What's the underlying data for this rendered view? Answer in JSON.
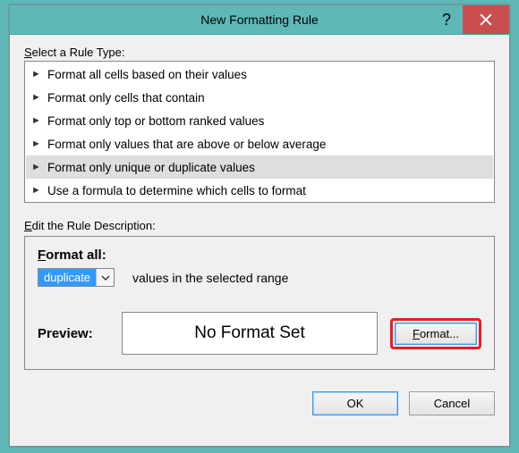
{
  "title": "New Formatting Rule",
  "selectRuleLabel": "Select a Rule Type:",
  "ruleTypes": [
    "Format all cells based on their values",
    "Format only cells that contain",
    "Format only top or bottom ranked values",
    "Format only values that are above or below average",
    "Format only unique or duplicate values",
    "Use a formula to determine which cells to format"
  ],
  "selectedRuleIndex": 4,
  "editLabel": "Edit the Rule Description:",
  "formatAllLabel": "Format all:",
  "dropdownValue": "duplicate",
  "suffixText": "values in the selected range",
  "previewLabel": "Preview:",
  "previewText": "No Format Set",
  "formatBtnLabel": "Format...",
  "okLabel": "OK",
  "cancelLabel": "Cancel"
}
